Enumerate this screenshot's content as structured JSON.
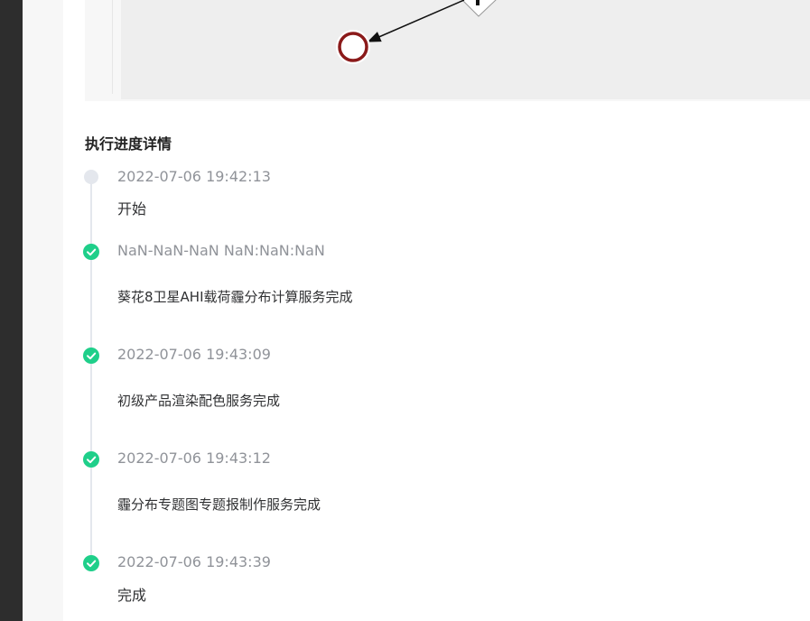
{
  "section_title": "执行进度详情",
  "timeline": [
    {
      "time": "2022-07-06 19:42:13",
      "text": "开始",
      "status": "pending"
    },
    {
      "time": "NaN-NaN-NaN NaN:NaN:NaN",
      "text": "葵花8卫星AHI载荷霾分布计算服务完成",
      "status": "done"
    },
    {
      "time": "2022-07-06 19:43:09",
      "text": "初级产品渲染配色服务完成",
      "status": "done"
    },
    {
      "time": "2022-07-06 19:43:12",
      "text": "霾分布专题图专题报制作服务完成",
      "status": "done"
    },
    {
      "time": "2022-07-06 19:43:39",
      "text": "完成",
      "status": "done"
    }
  ],
  "colors": {
    "done": "#1fcf8a",
    "pending": "#e4e7ed",
    "end_node": "#8b1a1a"
  },
  "icons": {
    "done": "check-circle-icon",
    "pending": "dot-icon"
  }
}
